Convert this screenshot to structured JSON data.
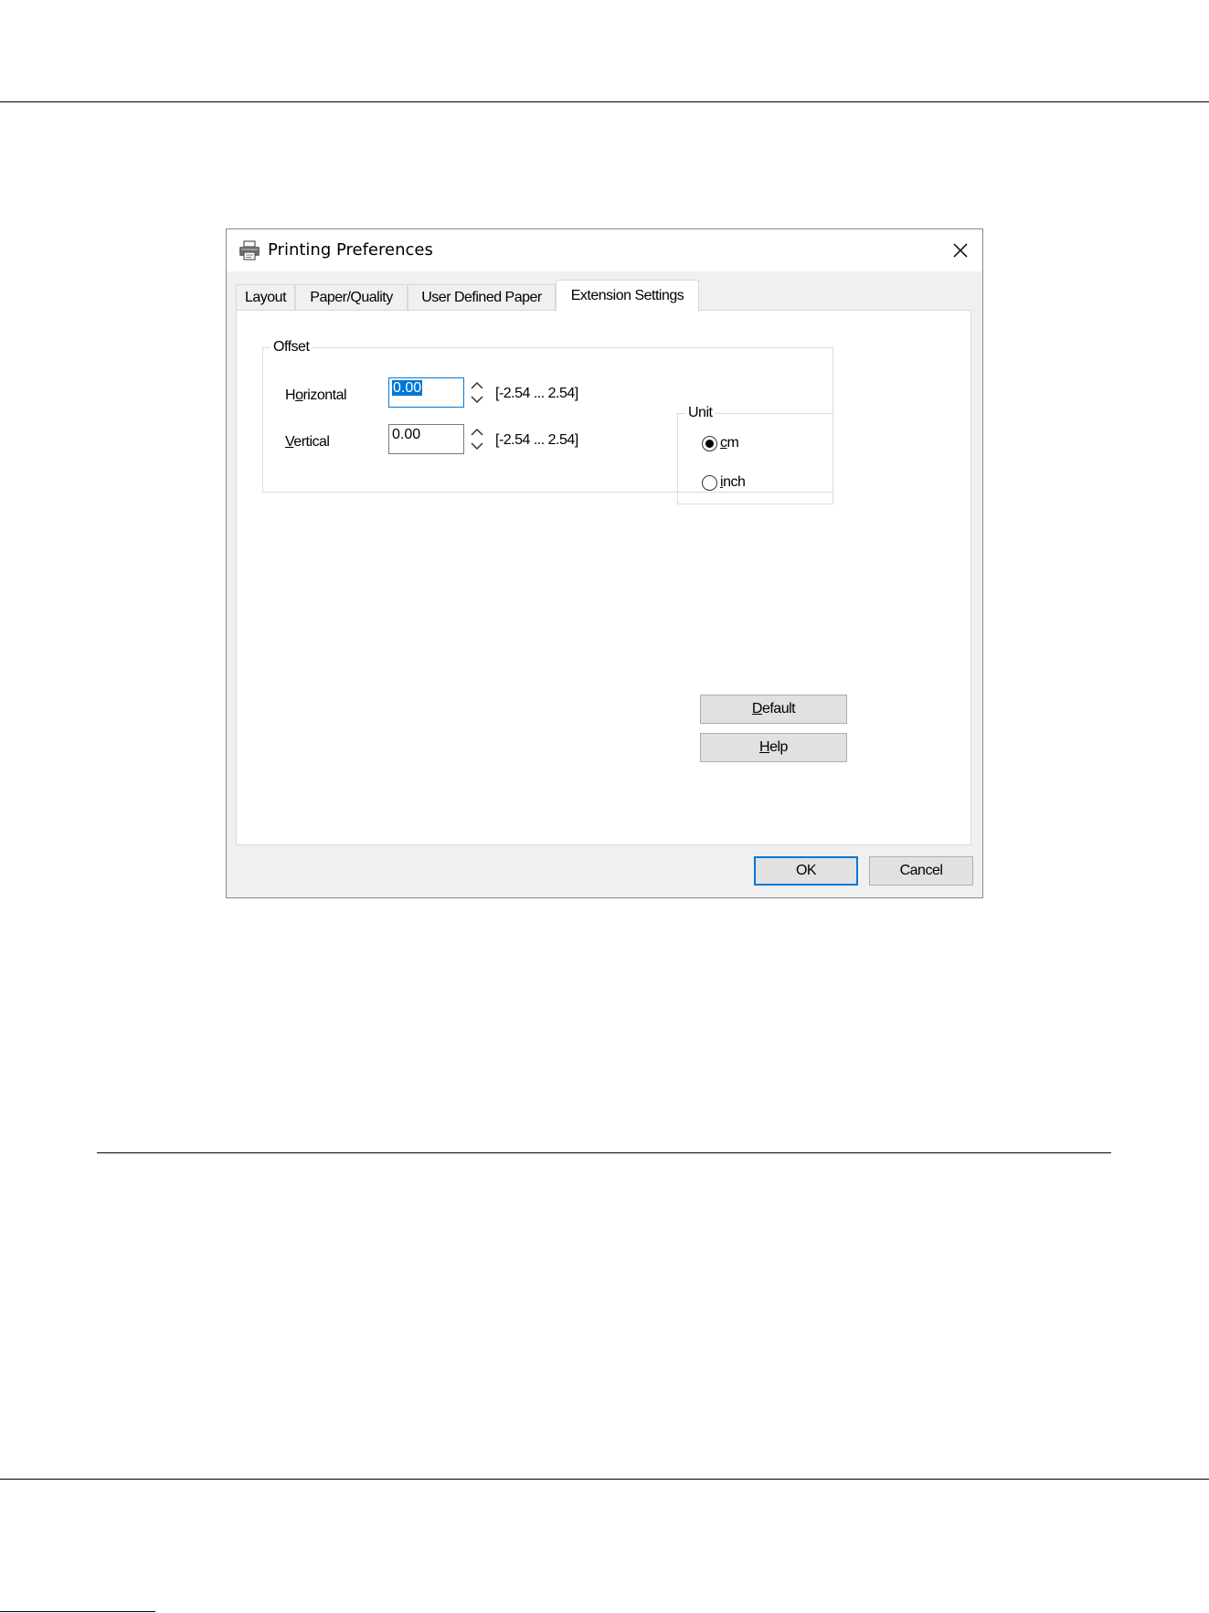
{
  "window": {
    "title": "Printing Preferences",
    "title_icon": "printer-icon",
    "close_icon": "close-icon"
  },
  "tabs": [
    {
      "label": "Layout",
      "active": false
    },
    {
      "label": "Paper/Quality",
      "active": false
    },
    {
      "label": "User Defined Paper",
      "active": false
    },
    {
      "label": "Extension Settings",
      "active": true
    }
  ],
  "offset": {
    "legend": "Offset",
    "horizontal": {
      "label_pre": "H",
      "label_u": "o",
      "label_post": "rizontal",
      "value": "0.00",
      "range": "[-2.54 ... 2.54]"
    },
    "vertical": {
      "label_pre": "",
      "label_u": "V",
      "label_post": "ertical",
      "value": "0.00",
      "range": "[-2.54 ... 2.54]"
    }
  },
  "unit": {
    "legend": "Unit",
    "options": [
      {
        "label_u": "c",
        "label_post": "m",
        "checked": true
      },
      {
        "label_u": "i",
        "label_post": "nch",
        "checked": false
      }
    ]
  },
  "buttons": {
    "default": {
      "label_u": "D",
      "label_post": "efault"
    },
    "help": {
      "label_u": "H",
      "label_post": "elp"
    },
    "ok": "OK",
    "cancel": "Cancel"
  },
  "colors": {
    "accent": "#0078d7",
    "dialog_bg": "#f0f0f0",
    "button_bg": "#e1e1e1"
  }
}
